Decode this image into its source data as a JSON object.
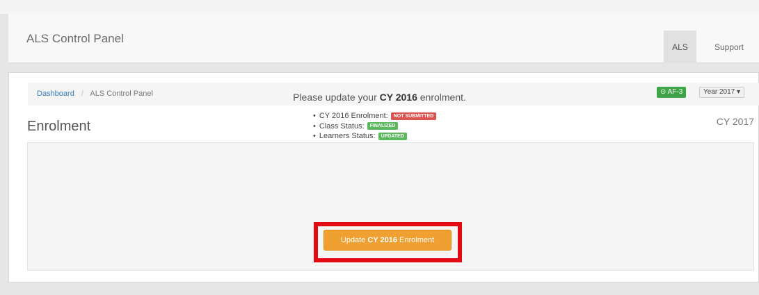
{
  "navbar": {
    "brand": "ALS Control Panel",
    "tabs": [
      {
        "label": "ALS",
        "active": true
      },
      {
        "label": "Support",
        "active": false
      }
    ]
  },
  "breadcrumb": {
    "items": [
      "Dashboard",
      "ALS Control Panel"
    ]
  },
  "controls": {
    "af_badge": "AF-3",
    "af_icon": "check-circle-icon",
    "year_dropdown": "Year 2017"
  },
  "page": {
    "title": "Enrolment",
    "cy_label": "CY 2017"
  },
  "notice": {
    "prefix": "Please update your ",
    "bold": "CY 2016",
    "suffix": " enrolment."
  },
  "status_items": [
    {
      "label": "CY 2016 Enrolment:",
      "badge": "NOT SUBMITTED",
      "badge_color": "#d9534f"
    },
    {
      "label": "Class Status:",
      "badge": "FINALIZED",
      "badge_color": "#5cb85c"
    },
    {
      "label": "Learners Status:",
      "badge": "UPDATED",
      "badge_color": "#5cb85c"
    }
  ],
  "update_button": {
    "prefix": "Update ",
    "bold": "CY 2016",
    "suffix": " Enrolment"
  },
  "colors": {
    "button": "#f0a030",
    "highlight": "#e30a13",
    "link": "#337ab7"
  }
}
